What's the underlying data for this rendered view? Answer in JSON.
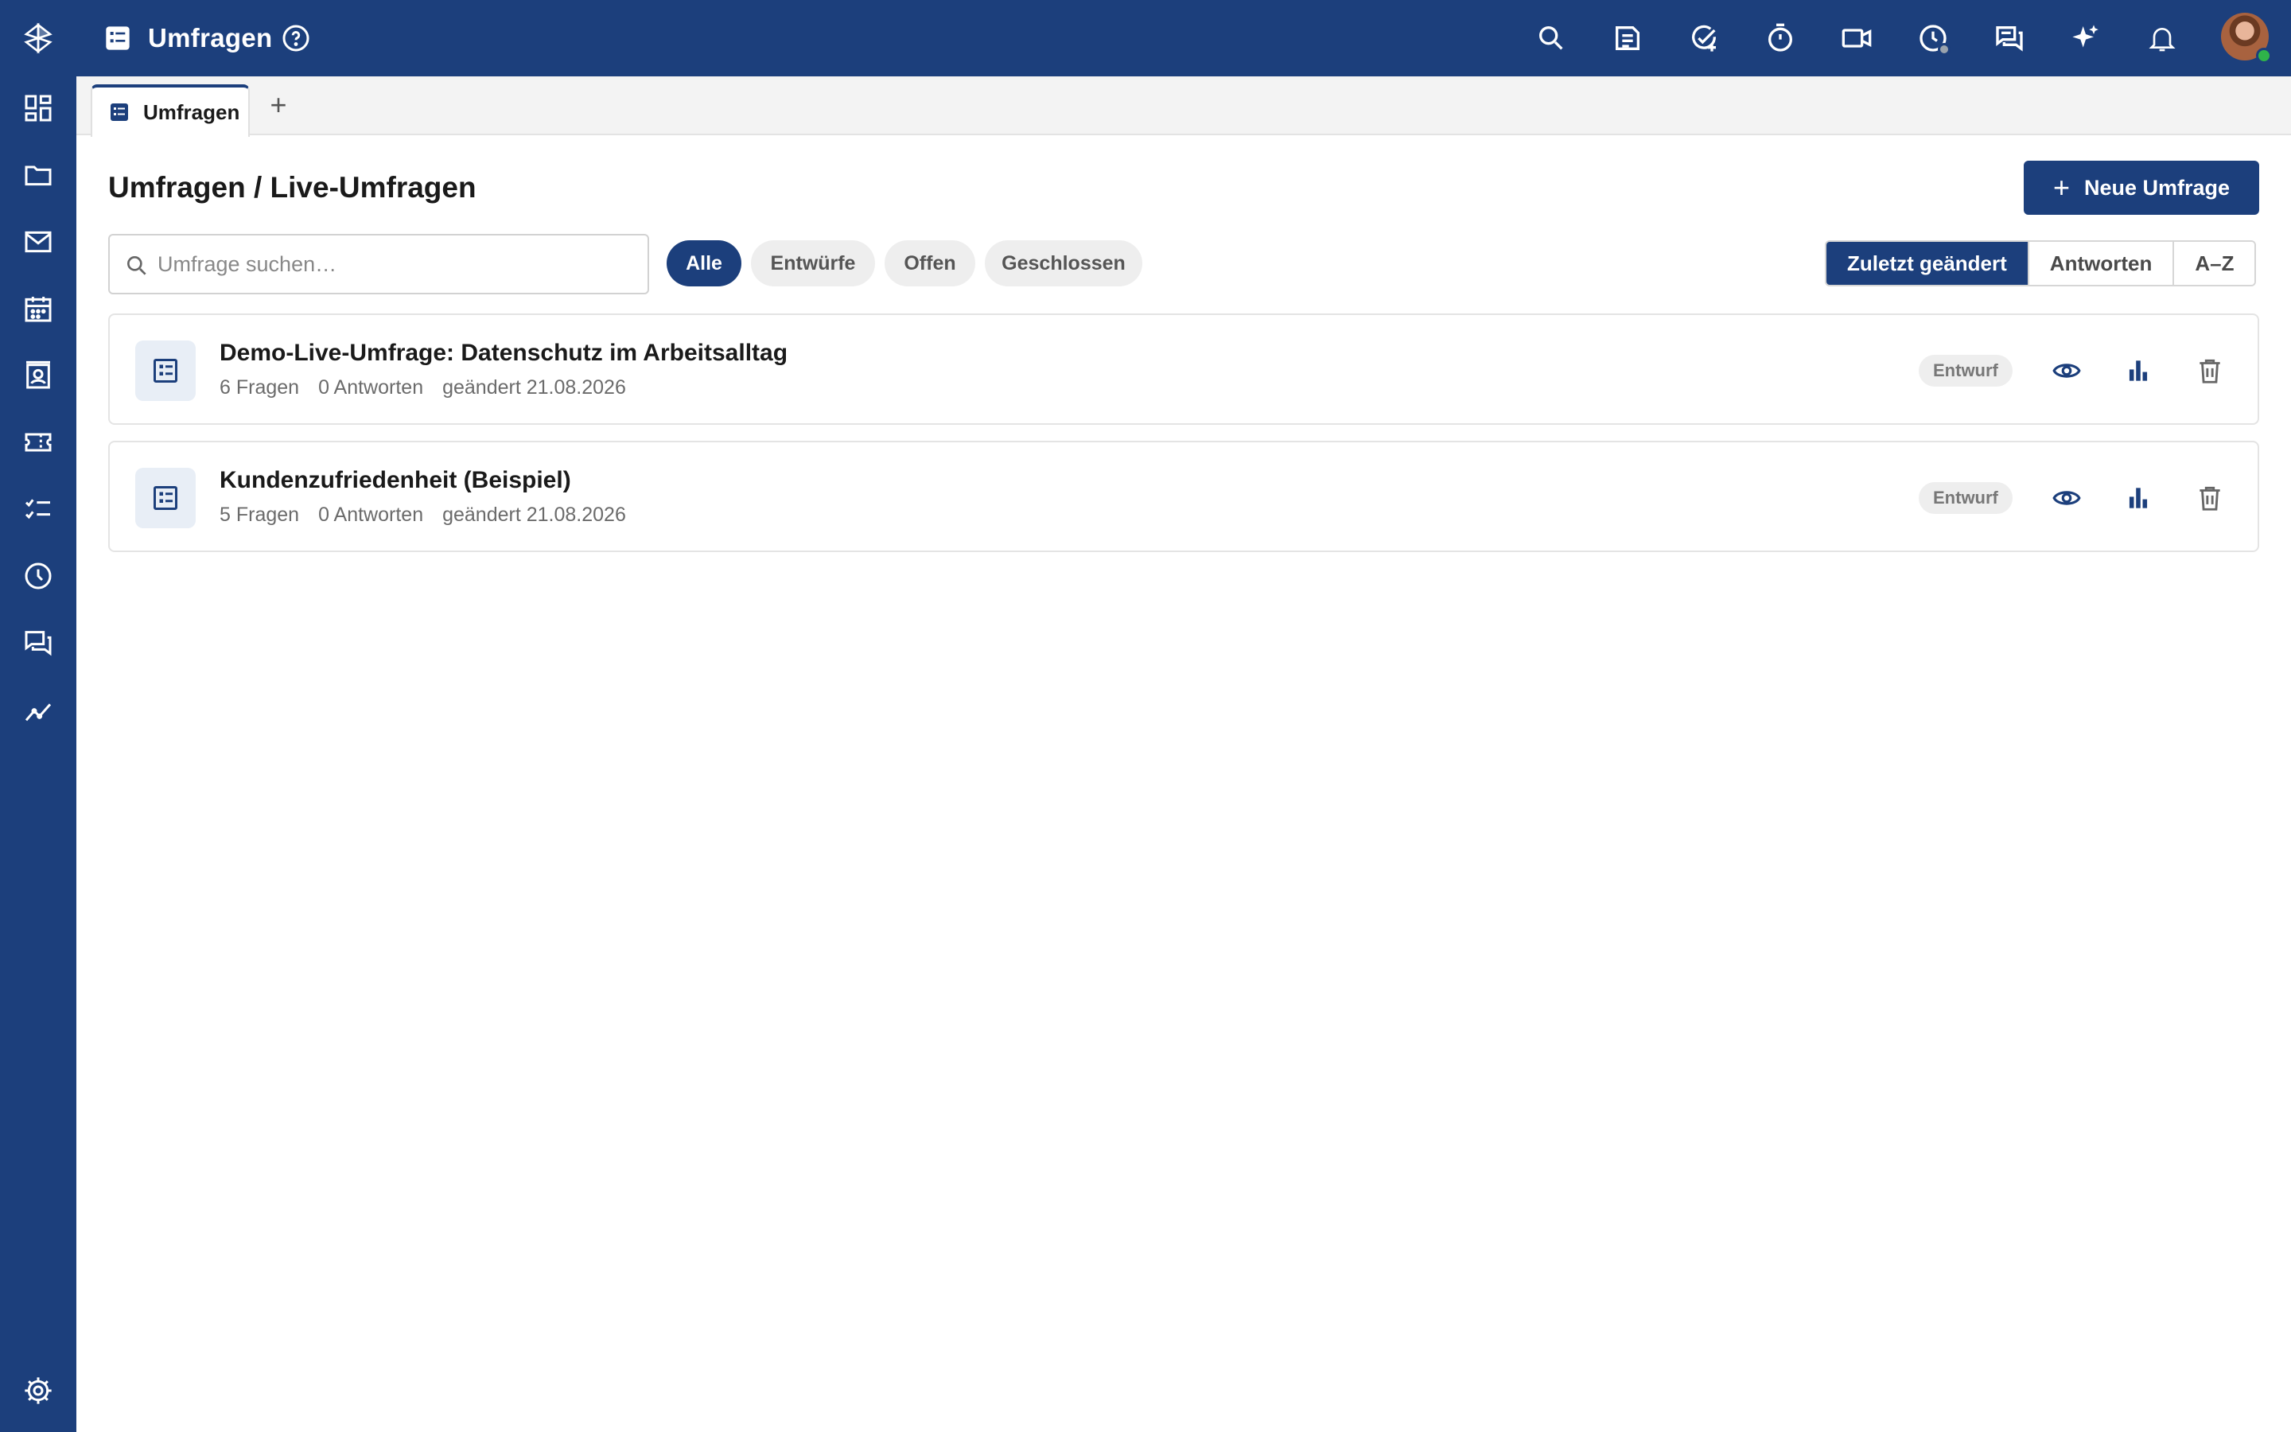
{
  "colors": {
    "primary": "#1c3f7c",
    "chip_bg": "#eeeeee",
    "online": "#2fb34a"
  },
  "sidebar": {
    "items": [
      {
        "icon": "switcher-icon"
      },
      {
        "icon": "dashboard-icon"
      },
      {
        "icon": "folder-icon"
      },
      {
        "icon": "mail-icon"
      },
      {
        "icon": "calendar-icon"
      },
      {
        "icon": "contacts-icon"
      },
      {
        "icon": "ticket-icon"
      },
      {
        "icon": "tasks-icon"
      },
      {
        "icon": "clock-icon"
      },
      {
        "icon": "chat-icon"
      },
      {
        "icon": "analytics-icon"
      },
      {
        "icon": "settings-icon"
      }
    ]
  },
  "header": {
    "title": "Umfragen",
    "icons": [
      "search-icon",
      "note-icon",
      "task-check-icon",
      "timer-icon",
      "video-icon",
      "time-status-icon",
      "messages-icon",
      "ai-sparkle-icon",
      "bell-icon"
    ]
  },
  "tabs": [
    {
      "label": "Umfragen"
    }
  ],
  "tab_add": "+",
  "page": {
    "title": "Umfragen / Live-Umfragen",
    "new_button": "Neue Umfrage",
    "new_plus": "+",
    "search_placeholder": "Umfrage suchen…",
    "search_value": ""
  },
  "filters": [
    {
      "label": "Alle",
      "active": true
    },
    {
      "label": "Entwürfe",
      "active": false
    },
    {
      "label": "Offen",
      "active": false
    },
    {
      "label": "Geschlossen",
      "active": false
    }
  ],
  "sort": [
    {
      "label": "Zuletzt geändert",
      "active": true
    },
    {
      "label": "Antworten",
      "active": false
    },
    {
      "label": "A–Z",
      "active": false
    }
  ],
  "surveys": [
    {
      "title": "Demo-Live-Umfrage: Datenschutz im Arbeitsalltag",
      "questions": "6 Fragen",
      "answers": "0 Antworten",
      "changed": "geändert 21.08.2026",
      "status": "Entwurf"
    },
    {
      "title": "Kundenzufriedenheit (Beispiel)",
      "questions": "5 Fragen",
      "answers": "0 Antworten",
      "changed": "geändert 21.08.2026",
      "status": "Entwurf"
    }
  ]
}
